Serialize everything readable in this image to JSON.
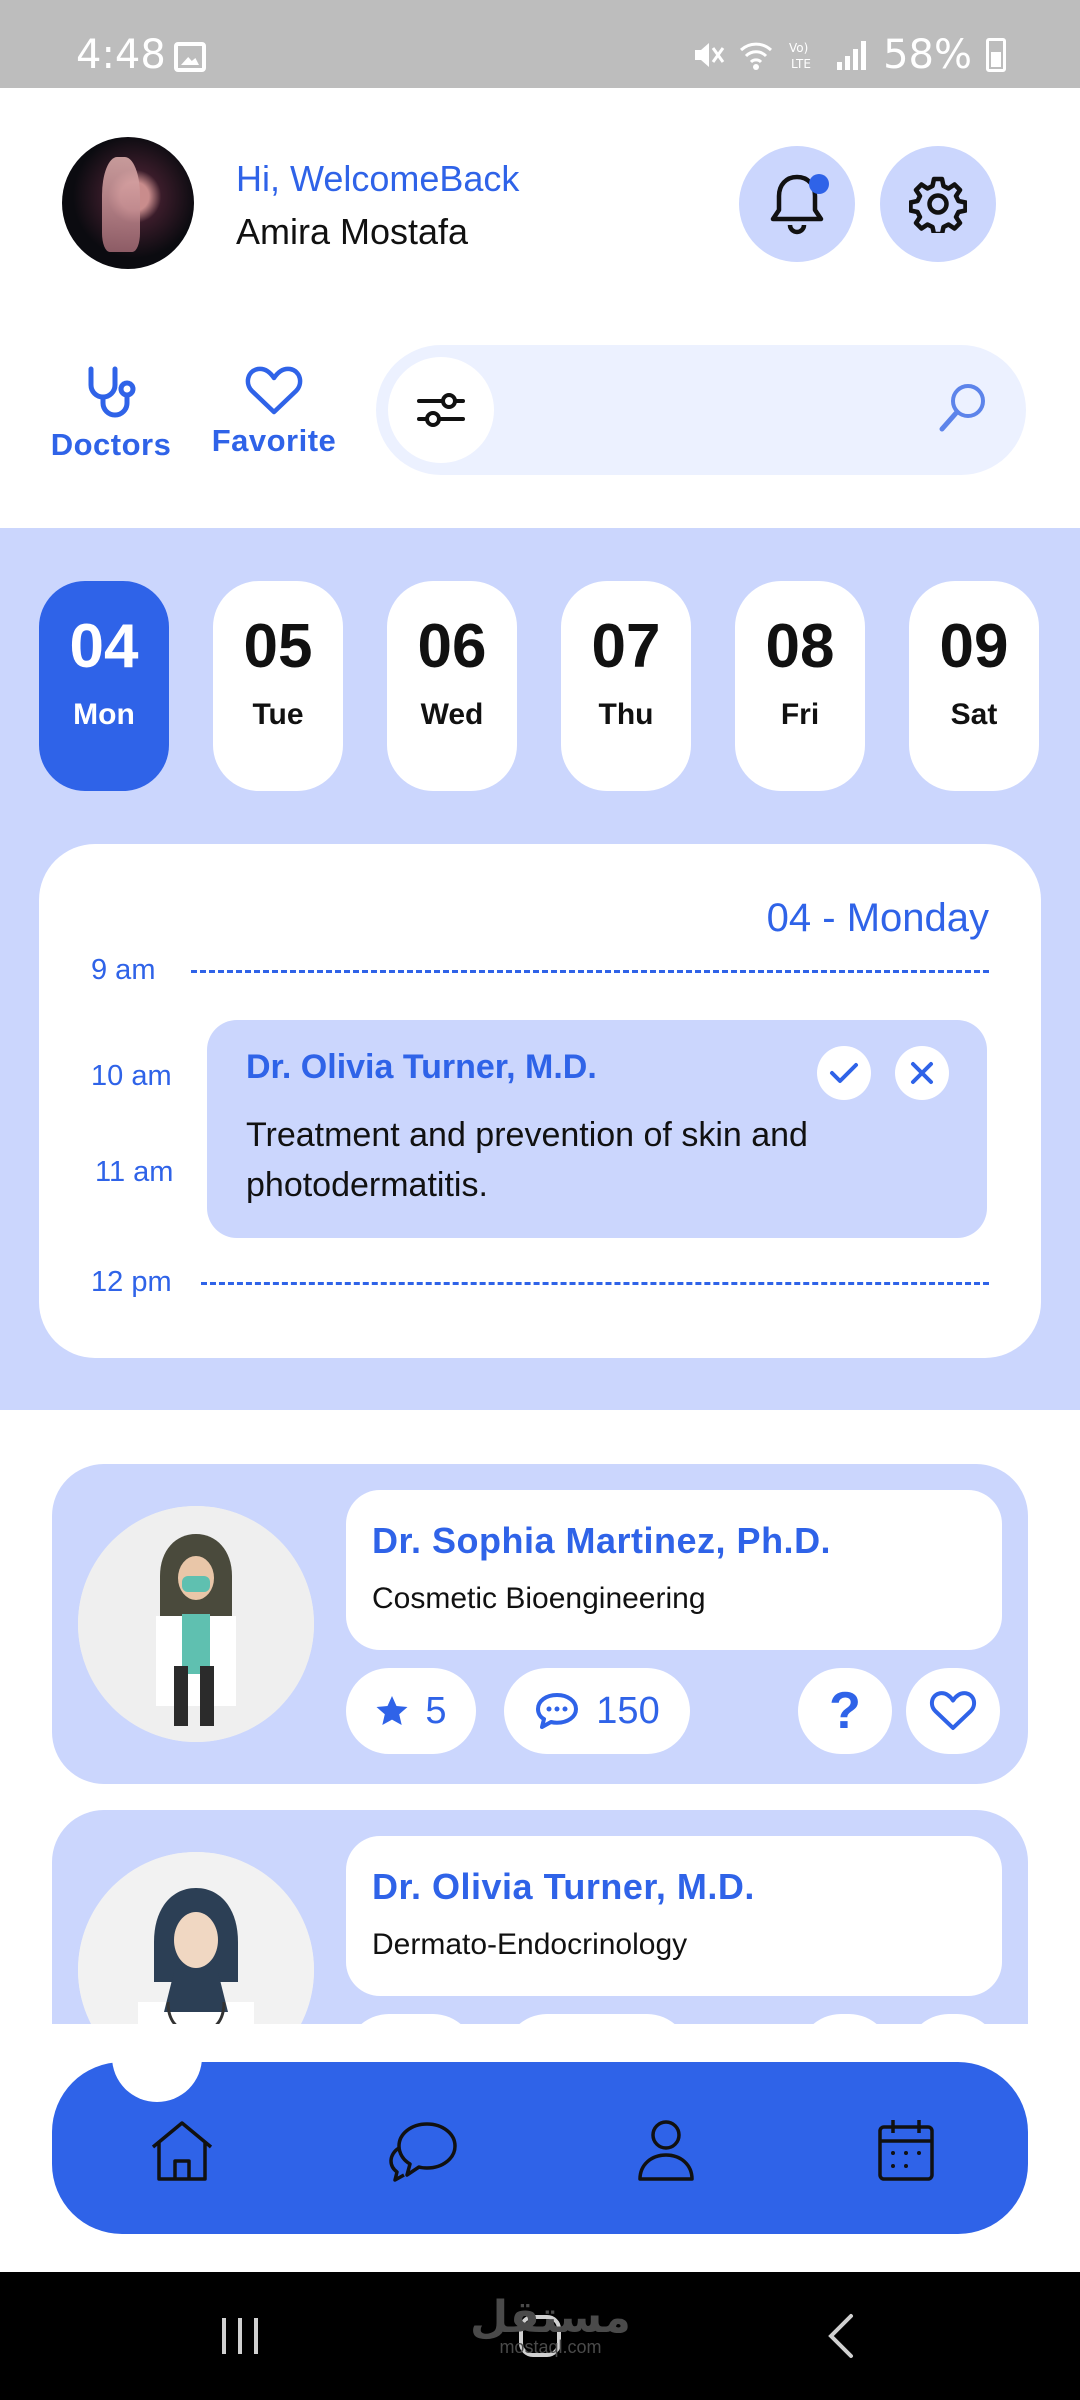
{
  "status_bar": {
    "time": "4:48",
    "battery": "58%",
    "signal_label": "Vo) LTE"
  },
  "header": {
    "greeting": "Hi, WelcomeBack",
    "user_name": "Amira Mostafa",
    "icons": {
      "notifications": "bell-icon",
      "settings": "gear-icon"
    }
  },
  "quick_nav": [
    {
      "label": "Doctors",
      "icon": "stethoscope-icon"
    },
    {
      "label": "Favorite",
      "icon": "heart-icon"
    }
  ],
  "search": {
    "icons": {
      "filter": "sliders-icon",
      "search": "search-icon"
    }
  },
  "days": [
    {
      "num": "04",
      "name": "Mon",
      "active": true
    },
    {
      "num": "05",
      "name": "Tue",
      "active": false
    },
    {
      "num": "06",
      "name": "Wed",
      "active": false
    },
    {
      "num": "07",
      "name": "Thu",
      "active": false
    },
    {
      "num": "08",
      "name": "Fri",
      "active": false
    },
    {
      "num": "09",
      "name": "Sat",
      "active": false
    }
  ],
  "schedule": {
    "date_label": "04 - Monday",
    "times": [
      "9 am",
      "10 am",
      "11 am",
      "12 pm"
    ],
    "appointment": {
      "doctor": "Dr. Olivia Turner, M.D.",
      "description": "Treatment and prevention of skin and photodermatitis."
    }
  },
  "doctors": [
    {
      "name": "Dr. Sophia Martinez, Ph.D.",
      "specialty": "Cosmetic Bioengineering",
      "rating": "5",
      "comments": "150"
    },
    {
      "name": "Dr. Olivia Turner, M.D.",
      "specialty": "Dermato-Endocrinology",
      "rating": "",
      "comments": ""
    }
  ],
  "bottom_nav": [
    "home-icon",
    "chat-icon",
    "profile-icon",
    "calendar-icon"
  ],
  "watermark": {
    "arabic": "مستقل",
    "latin": "mostaql.com"
  },
  "colors": {
    "accent": "#2f63e8",
    "accent_light": "#cbd6fd",
    "search_bg": "#ecf1ff"
  }
}
